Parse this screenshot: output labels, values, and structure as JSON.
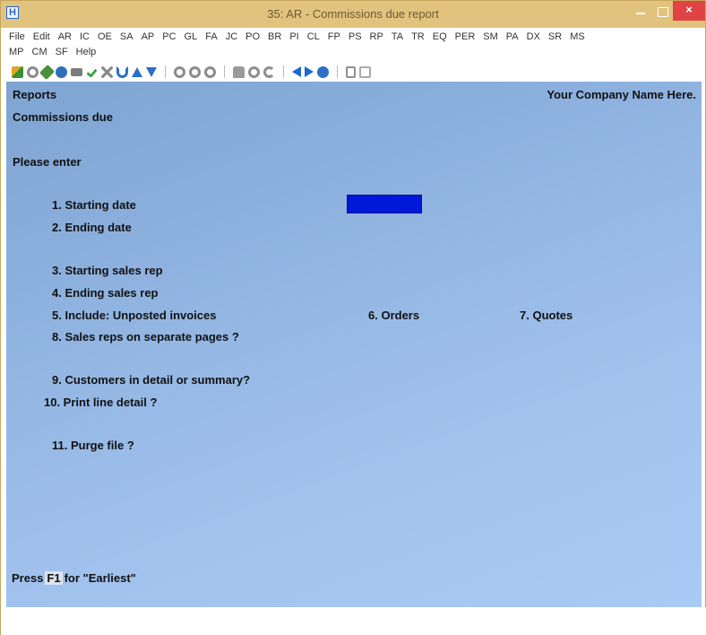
{
  "window": {
    "app_icon_glyph": "H",
    "title": "35: AR - Commissions due report",
    "close_glyph": "×",
    "colors": {
      "titlebar": "#e2c37d",
      "close": "#e04343",
      "form_background": "#9ebfeb",
      "active_field": "#0018d8"
    }
  },
  "menu": {
    "row1": [
      "File",
      "Edit",
      "AR",
      "IC",
      "OE",
      "SA",
      "AP",
      "PC",
      "GL",
      "FA",
      "JC",
      "PO",
      "BR",
      "PI",
      "CL",
      "FP",
      "PS",
      "RP",
      "TA",
      "TR",
      "EQ",
      "PER",
      "SM",
      "PA",
      "DX",
      "SR",
      "MS"
    ],
    "row2": [
      "MP",
      "CM",
      "SF",
      "Help"
    ]
  },
  "toolbar": {
    "icons": [
      "accept-icon",
      "cancel-icon",
      "tools-icon",
      "settings-icon",
      "print-icon",
      "check-icon",
      "delete-icon",
      "undo-icon",
      "up-arrow-icon",
      "down-arrow-icon",
      "first-icon",
      "previous-icon",
      "next-icon",
      "find-icon",
      "zoom-icon",
      "refresh-icon",
      "back-icon",
      "forward-icon",
      "help-icon",
      "calculator-icon",
      "notes-icon"
    ]
  },
  "header": {
    "module": "Reports",
    "company": "Your Company Name Here.",
    "report": "Commissions due",
    "prompt": "Please enter"
  },
  "fields": {
    "f1": "1. Starting date",
    "f2": "2. Ending date",
    "f3": "3. Starting sales rep",
    "f4": "4. Ending sales rep",
    "f5": "5. Include:  Unposted invoices",
    "f6": "6. Orders",
    "f7": "7. Quotes",
    "f8": "8. Sales reps on separate pages ?",
    "f9": "9. Customers in detail or summary?",
    "f10": "10. Print line detail ?",
    "f11": "11. Purge file ?"
  },
  "footer": {
    "press": "Press",
    "key": "F1",
    "hint": "for \"Earliest\""
  }
}
